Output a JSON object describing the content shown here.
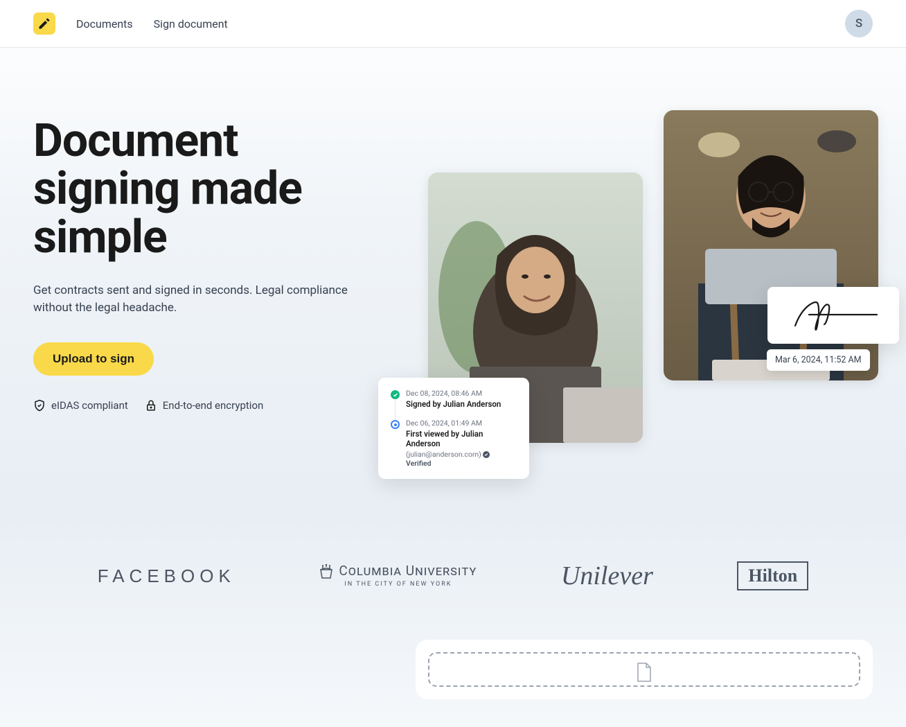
{
  "nav": {
    "link_documents": "Documents",
    "link_sign": "Sign document"
  },
  "avatar": {
    "initial": "S"
  },
  "hero": {
    "title": "Document signing made simple",
    "subtitle": "Get contracts sent and signed in seconds. Legal compliance without the legal headache.",
    "cta": "Upload to sign"
  },
  "trust": {
    "eidas": "eIDAS compliant",
    "encryption": "End-to-end encryption"
  },
  "activity": {
    "items": [
      {
        "time": "Dec 08, 2024, 08:46 AM",
        "title": "Signed by Julian Anderson"
      },
      {
        "time": "Dec 06, 2024, 01:49 AM",
        "title": "First viewed by Julian Anderson",
        "sub": "(julian@anderson.com)",
        "verified": "Verified"
      }
    ]
  },
  "timestamp": "Mar 6, 2024, 11:52 AM",
  "companies": {
    "facebook": "FACEBOOK",
    "columbia_main": "Columbia University",
    "columbia_sub": "IN THE CITY OF NEW YORK",
    "unilever": "Unilever",
    "hilton": "Hilton"
  }
}
